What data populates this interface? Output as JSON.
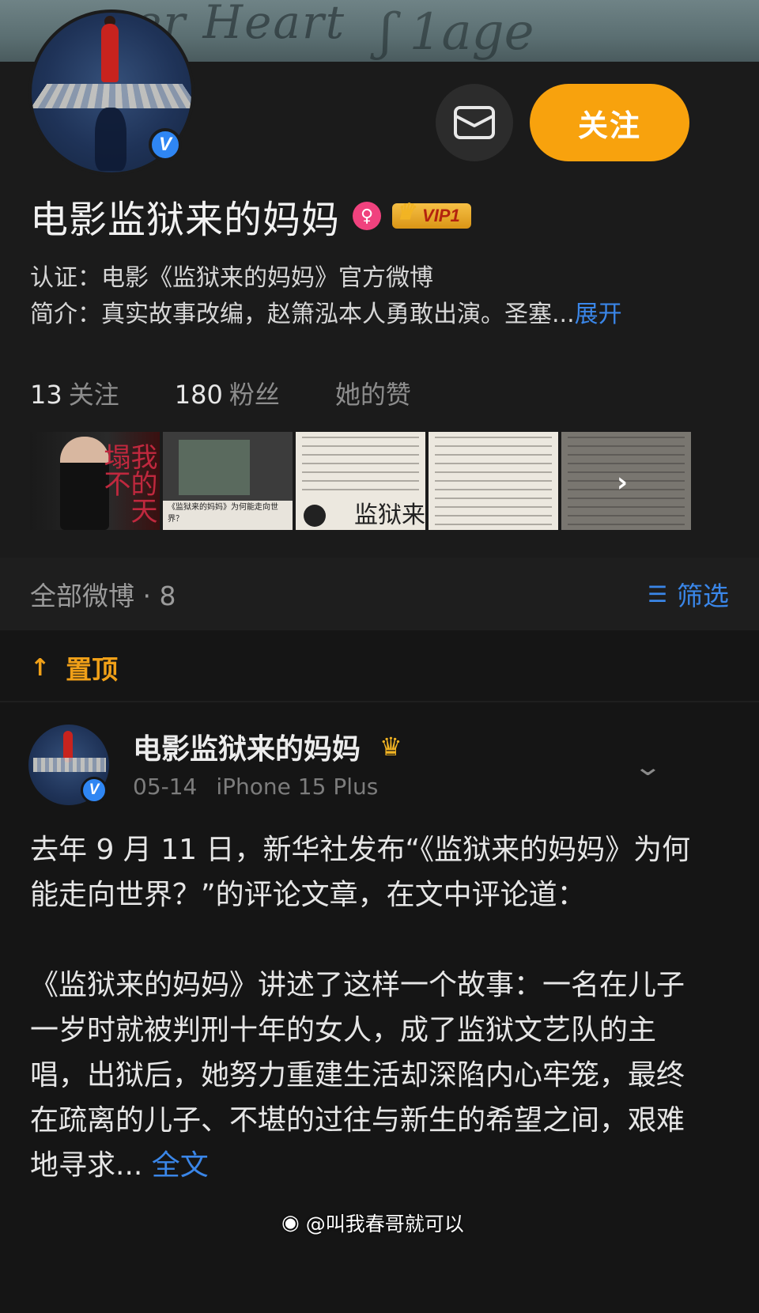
{
  "cover": {
    "script_text_1": "er Heart",
    "script_text_2": "ʃ 1age"
  },
  "header": {
    "follow_label": "关注",
    "message_icon": "envelope-icon"
  },
  "profile": {
    "name": "电影监狱来的妈妈",
    "gender_icon": "female-icon",
    "vip_label": "VIP1",
    "verify_mark": "V",
    "certification": "认证：电影《监狱来的妈妈》官方微博",
    "intro": "简介：真实故事改编，赵箫泓本人勇敢出演。圣塞...",
    "expand_label": "展开",
    "stats": {
      "following_num": "13",
      "following_label": "关注",
      "followers_num": "180",
      "followers_label": "粉丝",
      "likes_label": "她的赞"
    },
    "thumbnails": {
      "t1_text": "我的天塌不",
      "t2_caption": "《监狱来的妈妈》为何能走向世界？",
      "t3_calligraphy": "监狱来",
      "more_icon": "chevron-right-icon"
    }
  },
  "posts": {
    "title": "全部微博 · 8",
    "filter_label": "筛选",
    "filter_icon": "filter-icon",
    "pinned_label": "置顶",
    "pin_icon": "arrow-up-icon"
  },
  "post": {
    "author": "电影监狱来的妈妈",
    "verify_mark": "V",
    "date": "05-14",
    "device": "iPhone 15 Plus",
    "paragraph1": "去年 9 月 11 日，新华社发布“《监狱来的妈妈》为何能走向世界？”的评论文章，在文中评论道：",
    "paragraph2": "《监狱来的妈妈》讲述了这样一个故事：一名在儿子一岁时就被判刑十年的女人，成了监狱文艺队的主唱，出狱后，她努力重建生活却深陷内心牢笼，最终在疏离的儿子、不堪的过往与新生的希望之间，艰难地寻求...",
    "fulltext_label": "全文"
  },
  "watermark": {
    "text": "@叫我春哥就可以",
    "icon": "weibo-icon"
  },
  "colors": {
    "accent_orange": "#f8a20d",
    "link_blue": "#3a86e8",
    "background": "#151515",
    "verify_blue": "#2f86f3"
  }
}
